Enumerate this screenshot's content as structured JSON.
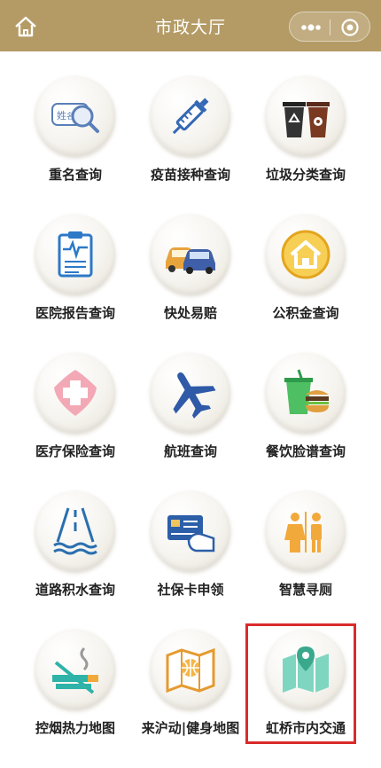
{
  "header": {
    "title": "市政大厅",
    "home_icon": "home-icon",
    "menu_icon": "more-dots-icon",
    "close_icon": "target-close-icon",
    "background_color": "#b49b66"
  },
  "items": [
    {
      "label": "重名查询",
      "icon": "name-search-icon"
    },
    {
      "label": "疫苗接种查询",
      "icon": "syringe-icon"
    },
    {
      "label": "垃圾分类查询",
      "icon": "trash-bins-icon"
    },
    {
      "label": "医院报告查询",
      "icon": "medical-report-icon"
    },
    {
      "label": "快处易赔",
      "icon": "cars-icon"
    },
    {
      "label": "公积金查询",
      "icon": "house-icon"
    },
    {
      "label": "医疗保险查询",
      "icon": "medical-cross-icon"
    },
    {
      "label": "航班查询",
      "icon": "airplane-icon"
    },
    {
      "label": "餐饮脸谱查询",
      "icon": "food-icon"
    },
    {
      "label": "道路积水查询",
      "icon": "road-water-icon"
    },
    {
      "label": "社保卡申领",
      "icon": "card-icon"
    },
    {
      "label": "智慧寻厕",
      "icon": "toilet-icon"
    },
    {
      "label": "控烟热力地图",
      "icon": "no-smoking-icon"
    },
    {
      "label": "来沪动|健身地图",
      "icon": "fitness-map-icon"
    },
    {
      "label": "虹桥市内交通",
      "icon": "map-pin-icon"
    }
  ],
  "highlighted_item": "虹桥市内交通",
  "highlight_color": "#d92b2b"
}
